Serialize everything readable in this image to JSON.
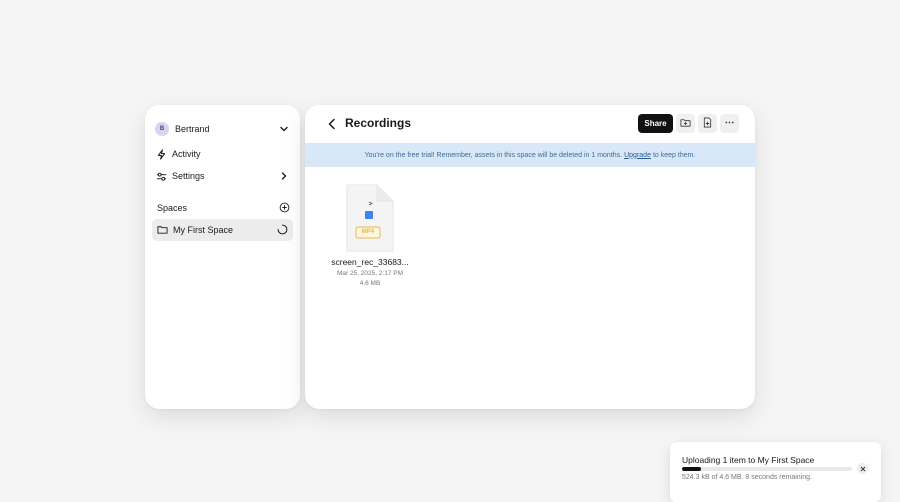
{
  "sidebar": {
    "user": {
      "initial": "B",
      "name": "Bertrand"
    },
    "nav": [
      {
        "label": "Activity",
        "icon": "lightning-icon"
      },
      {
        "label": "Settings",
        "icon": "sliders-icon"
      }
    ],
    "spaces_heading": "Spaces",
    "spaces": [
      {
        "label": "My First Space",
        "icon": "folder-icon",
        "status": "loading-spinner-icon"
      }
    ]
  },
  "main": {
    "title": "Recordings",
    "share_label": "Share",
    "tools": [
      "new-folder-icon",
      "upload-file-icon",
      "more-icon"
    ],
    "banner": {
      "text_before": "You're on the free trial! Remember, assets in this space will be deleted in 1 months.",
      "link": "Upgrade",
      "text_after": "to keep them."
    },
    "files": [
      {
        "name": "screen_rec_33683...",
        "date": "Mar 25, 2025, 2:17 PM",
        "size": "4.6 MB",
        "badge": "MP4"
      }
    ]
  },
  "upload": {
    "title": "Uploading 1 item to My First Space",
    "progress": 0.114,
    "detail": "524.3 kB of 4.6 MB. 8 seconds remaining."
  },
  "colors": {
    "banner_bg": "#d9e8f8",
    "banner_text": "#3d6b9a",
    "file_badge": "#e8b84a",
    "file_accent": "#3b82f6",
    "primary_button": "#111111"
  }
}
